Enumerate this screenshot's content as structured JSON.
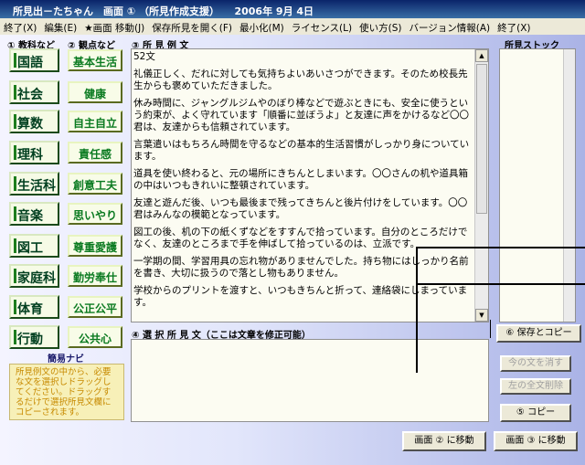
{
  "window": {
    "title": "所見出－たちゃん　画面 ① （所見作成支援）　　2006年 9月 4日"
  },
  "menu": [
    "終了(X)",
    "編集(E)",
    "★画面 移動(J)",
    "保存所見を開く(F)",
    "最小化(M)",
    "ライセンス(L)",
    "使い方(S)",
    "バージョン情報(A)",
    "終了(X)"
  ],
  "headers": {
    "subjects": "① 教科など",
    "viewpoints": "② 観点など",
    "examples": "③ 所 見 例 文",
    "stock": "所見ストック",
    "selected": "④ 選 択 所 見 文（ここは文章を修正可能）"
  },
  "subjects": [
    "国語",
    "社会",
    "算数",
    "理科",
    "生活科",
    "音楽",
    "図工",
    "家庭科",
    "体育",
    "行動"
  ],
  "viewpoints": [
    "基本生活",
    "健康",
    "自主自立",
    "責任感",
    "創意工夫",
    "思いやり",
    "尊重愛護",
    "勤労奉仕",
    "公正公平",
    "公共心"
  ],
  "navi": {
    "title": "簡易ナビ",
    "text": "所見例文の中から、必要な文を選択しドラッグしてください。ドラッグするだけで選択所見文欄にコピーされます。"
  },
  "examples": [
    "52文",
    "礼儀正しく、だれに対しても気持ちよいあいさつができます。そのため校長先生からも褒めていただきました。",
    "休み時間に、ジャングルジムやのぼり棒などで遊ぶときにも、安全に使うという約束が、よく守れています「順番に並ぼうよ」と友達に声をかけるなど〇〇君は、友達からも信頼されています。",
    "言葉遣いはもちろん時間を守るなどの基本的生活習慣がしっかり身についています。",
    "道具を使い終わると、元の場所にきちんとしまいます。〇〇さんの机や道具箱の中はいつもきれいに整頓されています。",
    "友達と遊んだ後、いつも最後まで残ってきちんと後片付けをしています。〇〇君はみんなの模範となっています。",
    "図工の後、机の下の紙くずなどをすすんで拾っています。自分のところだけでなく、友達のところまで手を伸ばして拾っているのは、立派です。",
    "一学期の間、学習用具の忘れ物がありませんでした。持ち物にはしっかり名前を書き、大切に扱うので落とし物もありません。",
    "学校からのプリントを渡すと、いつもきちんと折って、連絡袋にしまっています。"
  ],
  "buttons": {
    "save_copy": "⑥ 保存とコピー",
    "clear": "今の文を消す",
    "delete_left": "左の全文削除",
    "copy": "⑤ コピー",
    "goto2": "画面 ② に移動",
    "goto3": "画面 ③ に移動"
  }
}
